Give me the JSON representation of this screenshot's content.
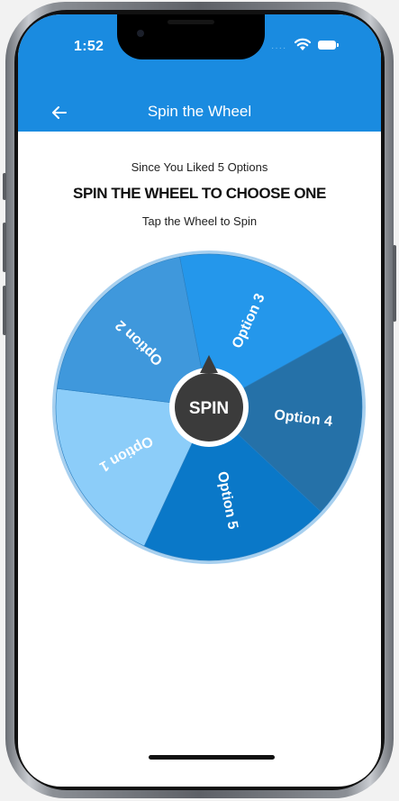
{
  "status_bar": {
    "time": "1:52",
    "background": "#1a8be0"
  },
  "nav": {
    "title": "Spin the Wheel",
    "back_icon": "arrow-left-icon"
  },
  "content": {
    "subtitle": "Since You Liked 5 Options",
    "headline": "SPIN THE WHEEL TO CHOOSE ONE",
    "hint": "Tap the Wheel to Spin"
  },
  "wheel": {
    "spin_label": "SPIN",
    "hub_color": "#3b3b3b",
    "rim_color": "#a8d0ef",
    "segments": [
      {
        "label": "Option 1",
        "color": "#8ccdf9"
      },
      {
        "label": "Option 2",
        "color": "#3f98dc"
      },
      {
        "label": "Option 3",
        "color": "#2497eb"
      },
      {
        "label": "Option 4",
        "color": "#2571a8"
      },
      {
        "label": "Option 5",
        "color": "#0a78c8"
      }
    ]
  }
}
